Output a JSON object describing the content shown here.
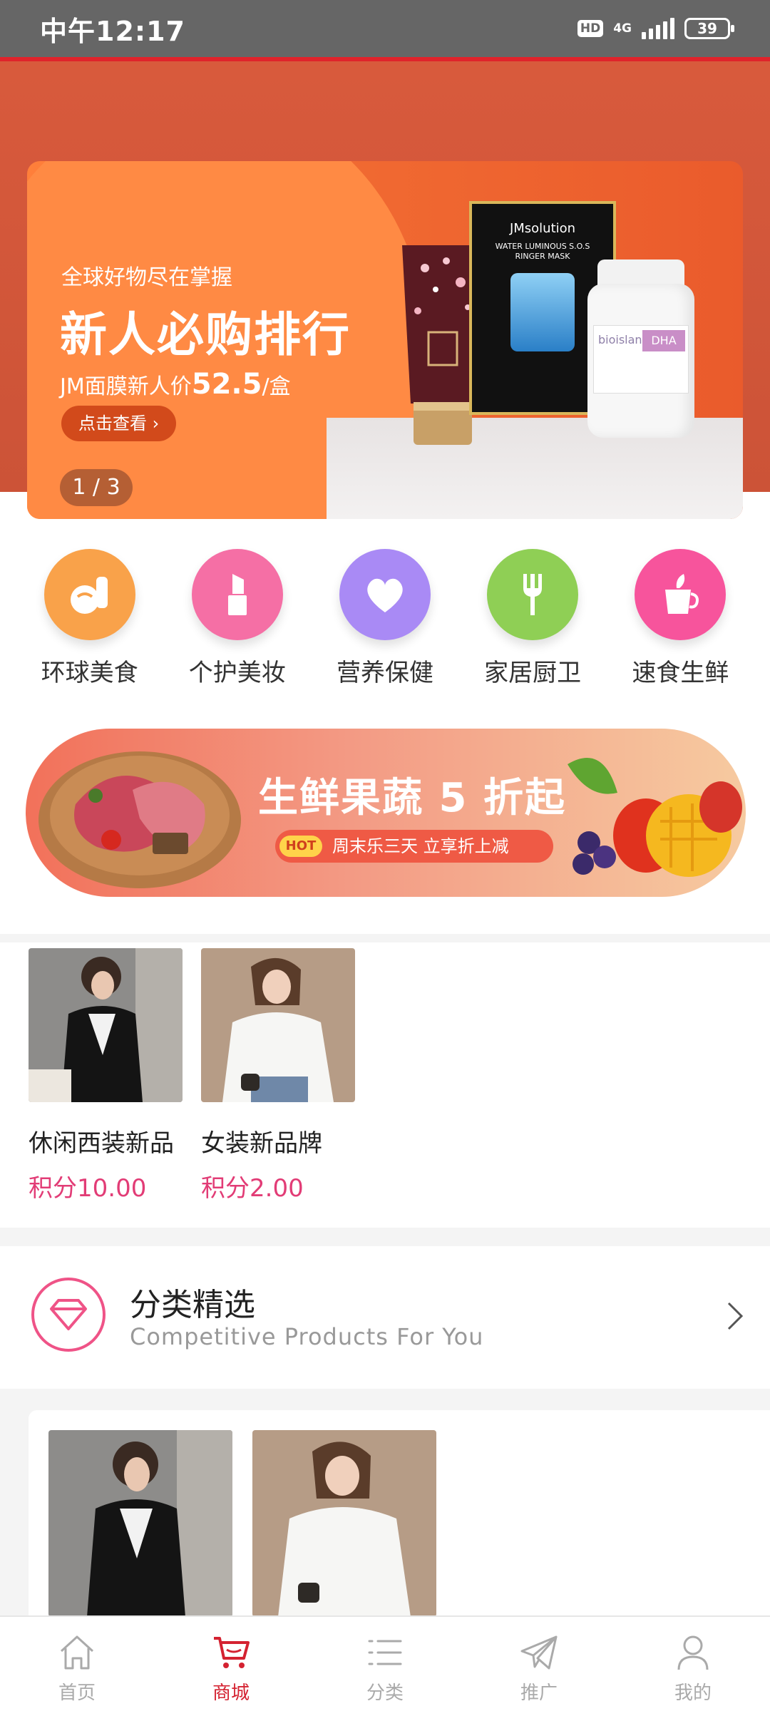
{
  "status_bar": {
    "time": "中午12:17",
    "hd": "HD",
    "network": "4G",
    "battery": "39"
  },
  "banner": {
    "tagline": "全球好物尽在掌握",
    "headline": "新人必购排行",
    "price_prefix": "JM面膜新人价",
    "price_value": "52.5",
    "price_suffix": "/盒",
    "cta": "点击查看 ›",
    "pager": "1 / 3",
    "mask_brand": "JMsolution",
    "mask_text": "WATER LUMINOUS S.O.S RINGER MASK",
    "bottle_brand": "bioisland",
    "bottle_label": "DHA"
  },
  "categories": [
    {
      "label": "环球美食",
      "icon": "food-icon",
      "color": "#f9a24a"
    },
    {
      "label": "个护美妆",
      "icon": "lipstick-icon",
      "color": "#f56fa5"
    },
    {
      "label": "营养保健",
      "icon": "heart-icon",
      "color": "#a98af5"
    },
    {
      "label": "家居厨卫",
      "icon": "fork-icon",
      "color": "#8fcf55"
    },
    {
      "label": "速食生鲜",
      "icon": "cup-icon",
      "color": "#f7549c"
    }
  ],
  "promo": {
    "title": "生鲜果蔬 5 折起",
    "hot": "HOT",
    "subtitle": "周末乐三天  立享折上减"
  },
  "products": [
    {
      "name": "休闲西装新品",
      "points": "积分10.00"
    },
    {
      "name": "女装新品牌",
      "points": "积分2.00"
    }
  ],
  "featured": {
    "title": "分类精选",
    "subtitle": "Competitive Products For You"
  },
  "tabs": [
    {
      "label": "首页",
      "icon": "home-icon"
    },
    {
      "label": "商城",
      "icon": "cart-icon",
      "active": true
    },
    {
      "label": "分类",
      "icon": "list-icon"
    },
    {
      "label": "推广",
      "icon": "paper-plane-icon"
    },
    {
      "label": "我的",
      "icon": "user-icon"
    }
  ]
}
